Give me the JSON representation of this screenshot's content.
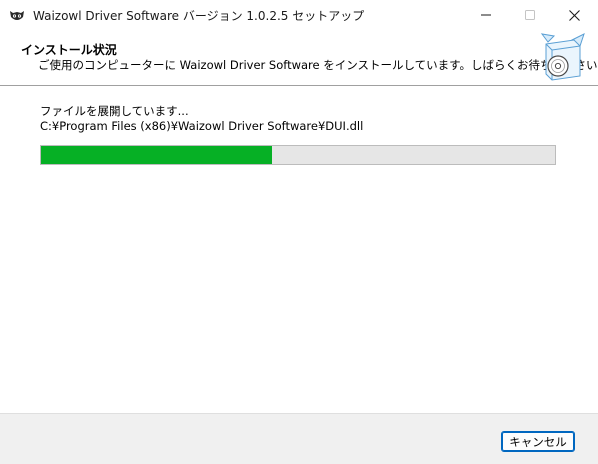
{
  "window": {
    "title": "Waizowl Driver Software バージョン 1.0.2.5 セットアップ"
  },
  "header": {
    "title": "インストール状況",
    "subtitle": "ご使用のコンピューターに Waizowl Driver Software をインストールしています。しばらくお待ちください。",
    "icon": "box-disc-icon"
  },
  "body": {
    "status": "ファイルを展開しています...",
    "current_file": "C:¥Program Files (x86)¥Waizowl Driver Software¥DUI.dll",
    "progress_fraction": 0.45
  },
  "footer": {
    "cancel_label": "キャンセル"
  },
  "colors": {
    "progress_fill": "#06b025",
    "progress_track": "#e6e6e6",
    "accent": "#0067c0"
  }
}
